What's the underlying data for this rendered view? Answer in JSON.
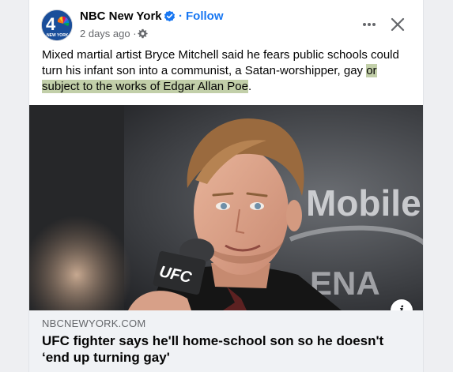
{
  "post": {
    "page_name": "NBC New York",
    "follow_label": "Follow",
    "separator": "·",
    "timestamp": "2 days ago ·",
    "avatar_text": "NEW YORK",
    "text_main": "Mixed martial artist Bryce Mitchell said he fears public schools could turn his infant son into a communist, a Satan-worshipper, gay ",
    "text_highlight": "or subject to the works of Edgar Allan Poe",
    "text_end": "."
  },
  "image": {
    "sign_text_1": "Mobile",
    "sign_text_2": "ENA",
    "mic_text": "UFC",
    "info_label": "i"
  },
  "link": {
    "domain": "NBCNEWYORK.COM",
    "headline": "UFC fighter says he'll home-school son so he doesn't ‘end up turning gay'"
  },
  "icons": {
    "verified": "verified-badge-icon",
    "privacy": "gear-icon",
    "more": "more-options-icon",
    "close": "close-icon",
    "info": "info-icon"
  },
  "colors": {
    "brand_blue": "#1877f2",
    "highlight": "#c2cfa9",
    "link_bg": "#f0f2f5",
    "secondary_text": "#65676b"
  }
}
